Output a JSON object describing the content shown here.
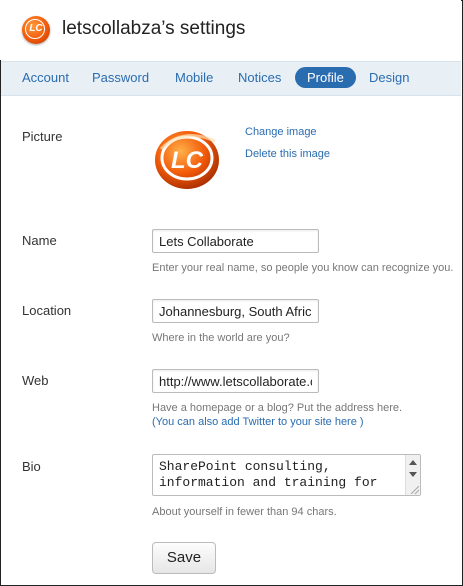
{
  "header": {
    "logo_text": "LC",
    "title": "letscollabza’s settings"
  },
  "tabs": [
    {
      "label": "Account",
      "active": false
    },
    {
      "label": "Password",
      "active": false
    },
    {
      "label": "Mobile",
      "active": false
    },
    {
      "label": "Notices",
      "active": false
    },
    {
      "label": "Profile",
      "active": true
    },
    {
      "label": "Design",
      "active": false
    }
  ],
  "picture": {
    "label": "Picture",
    "logo_text": "LC",
    "change_link": "Change image",
    "delete_link": "Delete this image"
  },
  "name": {
    "label": "Name",
    "value": "Lets Collaborate",
    "hint": "Enter your real name, so people you know can recognize you."
  },
  "location": {
    "label": "Location",
    "value": "Johannesburg, South Africa",
    "hint": "Where in the world are you?"
  },
  "web": {
    "label": "Web",
    "value": "http://www.letscollaborate.co.za",
    "hint": "Have a homepage or a blog? Put the address here.",
    "hint_link": "(You can also add Twitter to your site here )"
  },
  "bio": {
    "label": "Bio",
    "value": "SharePoint consulting,\ninformation and training for",
    "hint": "About yourself in fewer than 94 chars."
  },
  "save_label": "Save",
  "colors": {
    "accent": "#2a6cb0",
    "tabbar": "#e8f0f6",
    "logo_orange": "#f25a0a"
  }
}
